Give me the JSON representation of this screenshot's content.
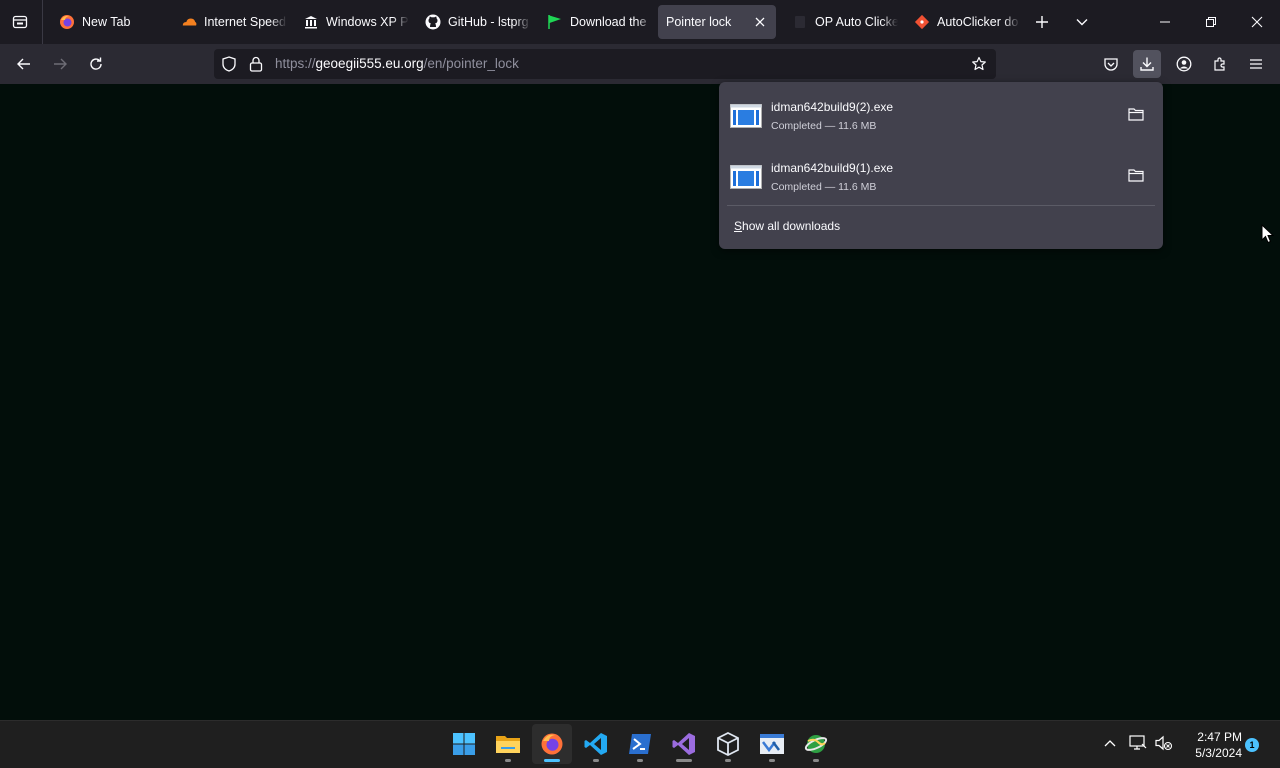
{
  "tabs": [
    {
      "label": "New Tab",
      "icon": "firefox-icon"
    },
    {
      "label": "Internet Speed",
      "icon": "cloudflare-icon"
    },
    {
      "label": "Windows XP P",
      "icon": "museum-icon"
    },
    {
      "label": "GitHub - lstprg",
      "icon": "github-icon"
    },
    {
      "label": "Download the",
      "icon": "green-flag-icon"
    },
    {
      "label": "Pointer lock",
      "icon": "none",
      "active": true
    },
    {
      "label": "OP Auto Clicke",
      "icon": "blank-icon"
    },
    {
      "label": "AutoClicker do",
      "icon": "git-icon"
    }
  ],
  "url": {
    "scheme": "https://",
    "host": "geoegii555.eu.org",
    "path": "/en/pointer_lock"
  },
  "downloads": {
    "items": [
      {
        "filename": "idman642build9(2).exe",
        "status": "Completed — 11.6 MB"
      },
      {
        "filename": "idman642build9(1).exe",
        "status": "Completed — 11.6 MB"
      }
    ],
    "show_all_accesskey": "S",
    "show_all_rest": "how all downloads"
  },
  "clock": {
    "time": "2:47 PM",
    "date": "5/3/2024"
  },
  "notification_count": "1",
  "colors": {
    "page_bg": "#020e0a",
    "toolbar": "#2b2a33",
    "tabbar": "#1c1b22",
    "panel": "#42414d",
    "accent": "#4cc2ff"
  }
}
